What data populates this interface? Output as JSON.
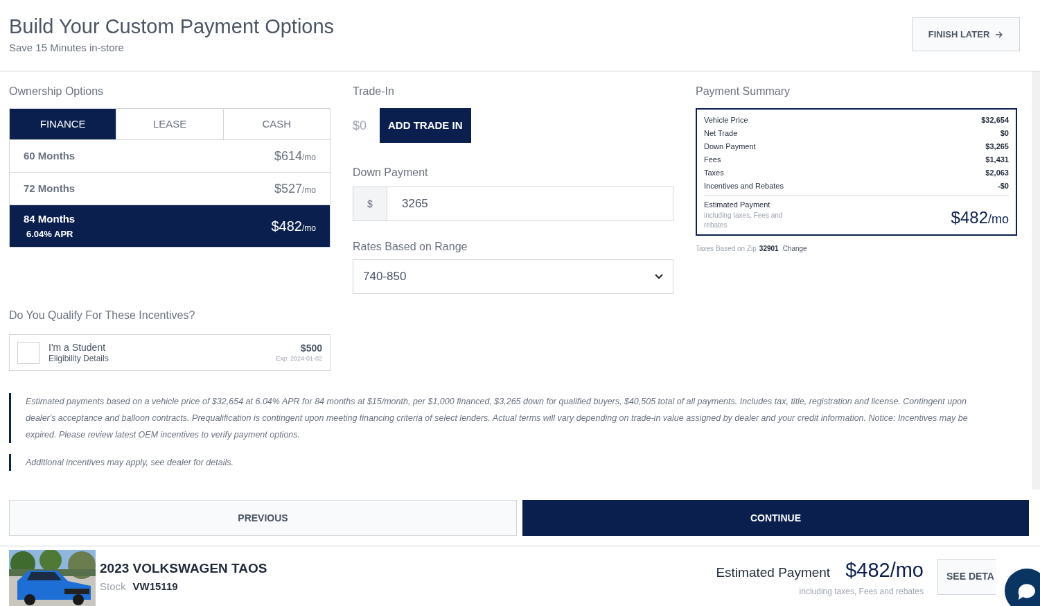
{
  "header": {
    "title": "Build Your Custom Payment Options",
    "subtitle": "Save 15 Minutes in-store",
    "finish_button": "FINISH LATER"
  },
  "ownership": {
    "heading": "Ownership Options",
    "tabs": [
      {
        "label": "FINANCE",
        "selected": true
      },
      {
        "label": "LEASE",
        "selected": false
      },
      {
        "label": "CASH",
        "selected": false
      }
    ],
    "terms": [
      {
        "label": "60 Months",
        "price": "$614",
        "unit": "/mo",
        "selected": false
      },
      {
        "label": "72 Months",
        "price": "$527",
        "unit": "/mo",
        "selected": false
      },
      {
        "label": "84 Months",
        "apr": "6.04% APR",
        "price": "$482",
        "unit": "/mo",
        "selected": true
      }
    ]
  },
  "trade_in": {
    "heading": "Trade-In",
    "value": "$0",
    "button": "ADD TRADE IN"
  },
  "down_payment": {
    "heading": "Down Payment",
    "prefix": "$",
    "value": "3265"
  },
  "rates": {
    "heading": "Rates Based on Range",
    "value": "740-850"
  },
  "summary": {
    "heading": "Payment Summary",
    "rows": [
      {
        "label": "Vehicle Price",
        "value": "$32,654"
      },
      {
        "label": "Net Trade",
        "value": "$0"
      },
      {
        "label": "Down Payment",
        "value": "$3,265"
      },
      {
        "label": "Fees",
        "value": "$1,431"
      },
      {
        "label": "Taxes",
        "value": "$2,063"
      },
      {
        "label": "Incentives and Rebates",
        "value": "-$0"
      }
    ],
    "estimate_label": "Estimated Payment",
    "estimate_note": "including taxes, Fees and rebates",
    "estimate_price": "$482",
    "estimate_unit": "/mo",
    "zip_label": "Taxes Based on Zip",
    "zip": "32901",
    "zip_link": "Change"
  },
  "incentives": {
    "heading": "Do You Qualify For These Incentives?",
    "items": [
      {
        "title": "I'm a Student",
        "details": "Eligibility Details",
        "amount": "$500",
        "expires": "Exp: 2024-01-02",
        "checked": false
      }
    ]
  },
  "disclaimers": [
    "Estimated payments based on a vehicle price of $32,654 at 6.04% APR for 84 months at $15/month, per $1,000 financed, $3,265 down for qualified buyers, $40,505 total of all payments. Includes tax, title, registration and license. Contingent upon dealer's acceptance and balloon contracts. Prequalification is contingent upon meeting financing criteria of select lenders. Actual terms will vary depending on trade-in value assigned by dealer and your credit information. Notice: Incentives may be expired. Please review latest OEM incentives to verify payment options.",
    "Additional incentives may apply, see dealer for details."
  ],
  "nav": {
    "previous": "PREVIOUS",
    "continue": "CONTINUE"
  },
  "vehicle": {
    "kind": "picture",
    "name": "2023 VOLKSWAGEN TAOS",
    "stock_label": "Stock",
    "stock": "VW15119",
    "estimate_label": "Estimated Payment",
    "estimate_price": "$482/mo",
    "estimate_note": "including taxes, Fees and rebates",
    "details_button": "SEE DETA"
  }
}
